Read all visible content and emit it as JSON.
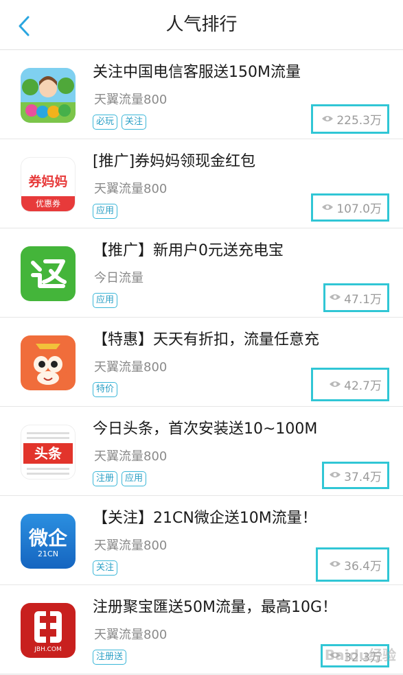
{
  "header": {
    "title": "人气排行"
  },
  "items": [
    {
      "title": "关注中国电信客服送150M流量",
      "source": "天翼流量800",
      "tags": [
        "必玩",
        "关注"
      ],
      "views": "225.3万"
    },
    {
      "title": "[推广]券妈妈领现金红包",
      "source": "天翼流量800",
      "tags": [
        "应用"
      ],
      "views": "107.0万",
      "icon_text_top": "券妈妈",
      "icon_text_bottom": "优惠券"
    },
    {
      "title": "【推广】新用户0元送充电宝",
      "source": "今日流量",
      "tags": [
        "应用"
      ],
      "views": "47.1万"
    },
    {
      "title": "【特惠】天天有折扣，流量任意充",
      "source": "天翼流量800",
      "tags": [
        "特价"
      ],
      "views": "42.7万"
    },
    {
      "title": "今日头条，首次安装送10~100M",
      "source": "天翼流量800",
      "tags": [
        "注册",
        "应用"
      ],
      "views": "37.4万",
      "icon_text": "头条"
    },
    {
      "title": "【关注】21CN微企送10M流量！",
      "source": "天翼流量800",
      "tags": [
        "关注"
      ],
      "views": "36.4万",
      "icon_text": "微企",
      "icon_subtext": "21CN"
    },
    {
      "title": "注册聚宝匯送50M流量，最高10G！",
      "source": "天翼流量800",
      "tags": [
        "注册送"
      ],
      "views": "32.3万",
      "icon_subtext": "JBH.COM"
    }
  ],
  "watermark": "Baidu经验",
  "colors": {
    "highlight_box": "#30c6d5",
    "tag_border": "#38b6d8",
    "back_arrow": "#2aa6e0"
  }
}
